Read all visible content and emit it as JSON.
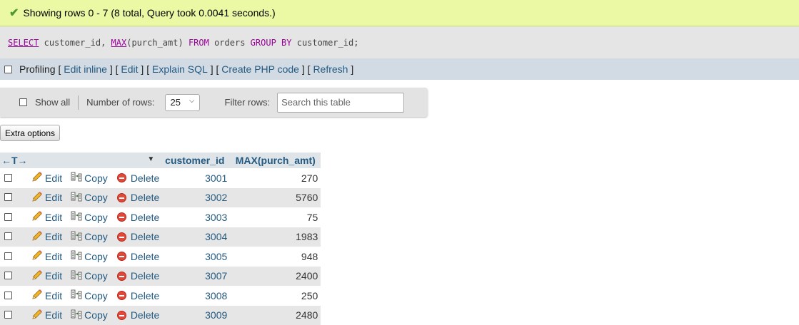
{
  "success": {
    "message": "Showing rows 0 - 7 (8 total, Query took 0.0041 seconds.)",
    "icon": "checkmark-icon"
  },
  "sql": {
    "select": "SELECT",
    "cols_a": "customer_id,",
    "max_fn": "MAX",
    "max_arg": "(purch_amt)",
    "from": "FROM",
    "table": "orders",
    "group": "GROUP",
    "by": "BY",
    "group_col": "customer_id;"
  },
  "tools": {
    "profiling": "Profiling",
    "edit_inline": "Edit inline",
    "edit": "Edit",
    "explain_sql": "Explain SQL",
    "create_php": "Create PHP code",
    "refresh": "Refresh"
  },
  "nav": {
    "show_all": "Show all",
    "number_of_rows_label": "Number of rows:",
    "number_of_rows_value": "25",
    "filter_label": "Filter rows:",
    "filter_placeholder": "Search this table"
  },
  "extra_options": "Extra options",
  "table": {
    "header_arrows": "←T→",
    "col_customer_id": "customer_id",
    "col_max": "MAX(purch_amt)",
    "action_labels": {
      "edit": "Edit",
      "copy": "Copy",
      "delete": "Delete"
    },
    "rows": [
      {
        "customer_id": "3001",
        "max": "270"
      },
      {
        "customer_id": "3002",
        "max": "5760"
      },
      {
        "customer_id": "3003",
        "max": "75"
      },
      {
        "customer_id": "3004",
        "max": "1983"
      },
      {
        "customer_id": "3005",
        "max": "948"
      },
      {
        "customer_id": "3007",
        "max": "2400"
      },
      {
        "customer_id": "3008",
        "max": "250"
      },
      {
        "customer_id": "3009",
        "max": "2480"
      }
    ]
  },
  "colors": {
    "success_bg": "#ebf8a4",
    "link": "#235a81",
    "delete_red": "#e0483a"
  }
}
